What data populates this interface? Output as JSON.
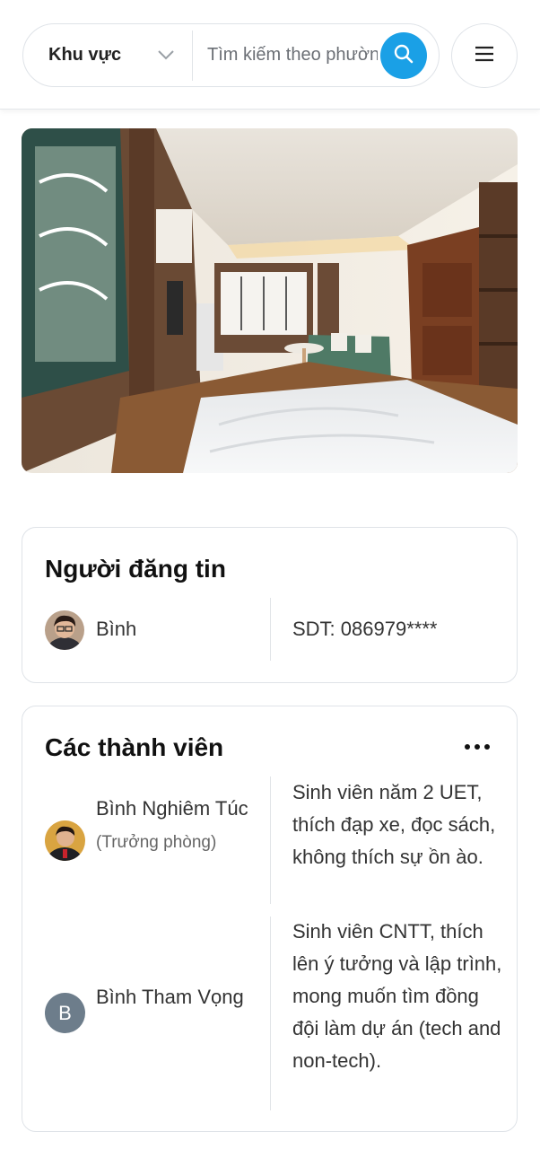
{
  "header": {
    "region_label": "Khu vực",
    "search_placeholder": "Tìm kiếm theo phường",
    "accent_color": "#1aa0e6",
    "icons": [
      "chevron-down-icon",
      "search-icon",
      "hamburger-menu-icon"
    ]
  },
  "listing": {
    "photo": "room-photo"
  },
  "poster": {
    "title": "Người đăng tin",
    "name": "Bình",
    "phone": "SDT: 086979****"
  },
  "members": {
    "title": "Các thành viên",
    "items": [
      {
        "name": "Bình Nghiêm Túc",
        "role": "(Trưởng phòng)",
        "description": "Sinh viên năm 2 UET, thích đạp xe, đọc sách, không thích sự ồn ào."
      },
      {
        "name": "Bình Tham Vọng",
        "avatar_letter": "B",
        "description": "Sinh viên CNTT, thích lên ý tưởng và lập trình, mong muốn tìm đồng đội làm dự án (tech and non-tech)."
      }
    ]
  }
}
